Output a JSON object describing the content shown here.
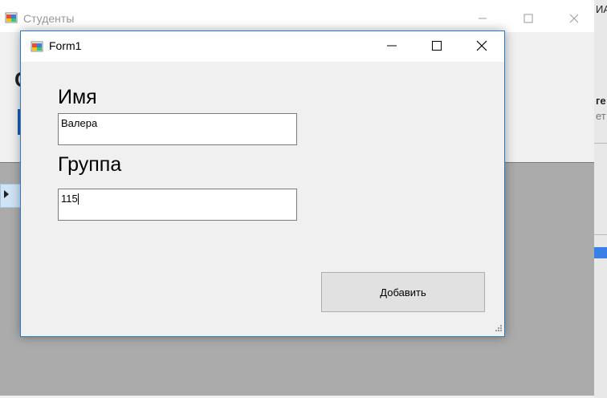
{
  "background_window": {
    "title": "Студенты",
    "big_letter": "С",
    "right_fragments": [
      "ИА",
      "ге",
      "ет"
    ],
    "minimize_icon": "minimize-icon",
    "maximize_icon": "maximize-icon",
    "close_icon": "close-icon"
  },
  "form1": {
    "title": "Form1",
    "app_icon": "winforms-app-icon",
    "labels": {
      "name": "Имя",
      "group": "Группа"
    },
    "fields": {
      "name_value": "Валера",
      "group_value": "115"
    },
    "add_button_label": "Добавить"
  },
  "colors": {
    "accent_border": "#2b78c7",
    "window_bg": "#f0f0f0",
    "grid_bg": "#ababab"
  }
}
